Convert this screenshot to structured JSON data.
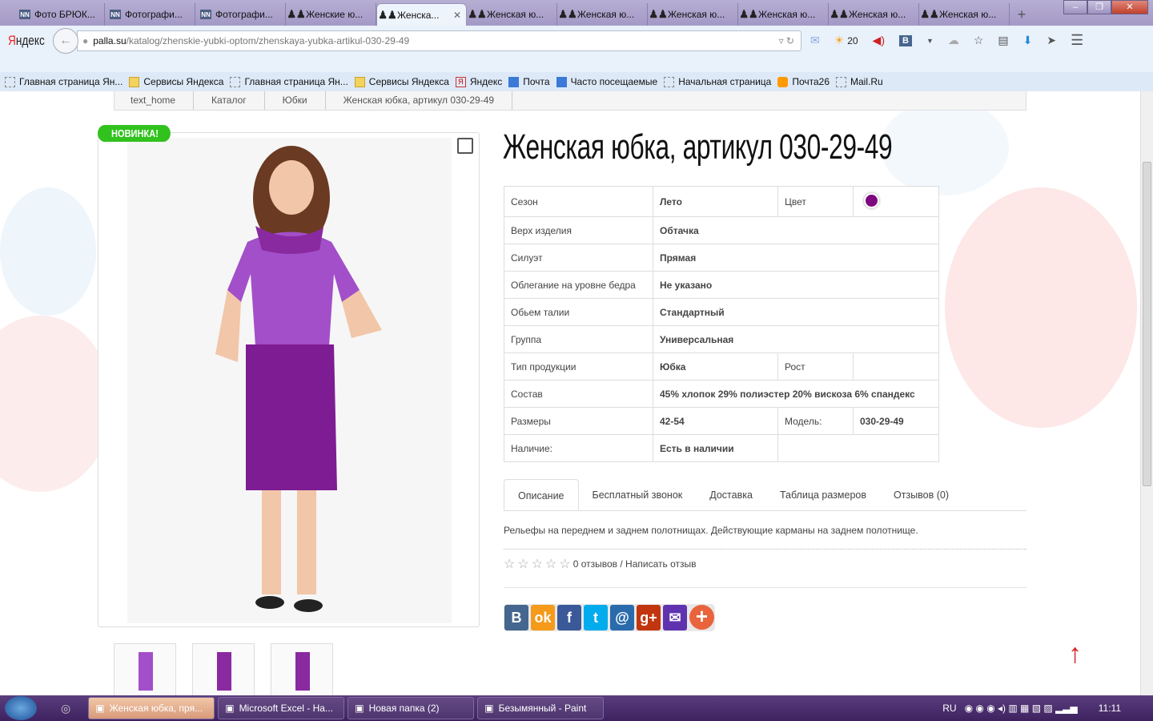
{
  "browser": {
    "tabs": [
      {
        "label": "Фото БРЮК...",
        "icon": "nn"
      },
      {
        "label": "Фотографи...",
        "icon": "nn"
      },
      {
        "label": "Фотографи...",
        "icon": "nn"
      },
      {
        "label": "Женские ю...",
        "icon": "palla"
      },
      {
        "label": "Женска...",
        "icon": "palla",
        "active": true
      },
      {
        "label": "Женская ю...",
        "icon": "palla"
      },
      {
        "label": "Женская ю...",
        "icon": "palla"
      },
      {
        "label": "Женская ю...",
        "icon": "palla"
      },
      {
        "label": "Женская ю...",
        "icon": "palla"
      },
      {
        "label": "Женская ю...",
        "icon": "palla"
      },
      {
        "label": "Женская ю...",
        "icon": "palla"
      }
    ],
    "logo_first": "Я",
    "logo_rest": "ндекс",
    "url_domain": "palla.su",
    "url_path": "/katalog/zhenskie-yubki-optom/zhenskaya-yubka-artikul-030-29-49",
    "weather_temp": "20",
    "bookmarks": [
      {
        "label": "Главная страница Ян...",
        "icon": "blank"
      },
      {
        "label": "Сервисы Яндекса",
        "icon": "folder"
      },
      {
        "label": "Главная страница Ян...",
        "icon": "blank"
      },
      {
        "label": "Сервисы Яндекса",
        "icon": "folder"
      },
      {
        "label": "Яндекс",
        "icon": "yandex"
      },
      {
        "label": "Почта",
        "icon": "mail"
      },
      {
        "label": "Часто посещаемые",
        "icon": "search"
      },
      {
        "label": "Начальная страница",
        "icon": "blank"
      },
      {
        "label": "Почта26",
        "icon": "at"
      },
      {
        "label": "Mail.Ru",
        "icon": "blank"
      }
    ]
  },
  "breadcrumb": [
    "text_home",
    "Каталог",
    "Юбки",
    "Женская юбка, артикул 030-29-49"
  ],
  "product": {
    "badge": "НОВИНКА!",
    "title": "Женская юбка, артикул 030-29-49",
    "color_swatch": "#7d0680",
    "specs": {
      "season_label": "Сезон",
      "season": "Лето",
      "color_label": "Цвет",
      "top_label": "Верх изделия",
      "top": "Обтачка",
      "silhouette_label": "Силуэт",
      "silhouette": "Прямая",
      "hip_label": "Облегание на уровне бедра",
      "hip": "Не указано",
      "waist_label": "Обьем талии",
      "waist": "Стандартный",
      "group_label": "Группа",
      "group": "Универсальная",
      "type_label": "Тип продукции",
      "type": "Юбка",
      "height_label": "Рост",
      "composition_label": "Состав",
      "composition": "45% хлопок 29% полиэстер 20% вискоза 6% спандекс",
      "sizes_label": "Размеры",
      "sizes": "42-54",
      "model_label": "Модель:",
      "model": "030-29-49",
      "stock_label": "Наличие:",
      "stock": "Есть в наличии"
    },
    "tabs": [
      "Описание",
      "Бесплатный звонок",
      "Доставка",
      "Таблица размеров",
      "Отзывов (0)"
    ],
    "description": "Рельефы на переднем и заднем полотнищах. Действующие карманы на заднем полотнище.",
    "rating": 0,
    "reviews_text": "0 отзывов / Написать отзыв",
    "share": [
      {
        "label": "B",
        "color": "#45668e"
      },
      {
        "label": "ok",
        "color": "#f59a1b"
      },
      {
        "label": "f",
        "color": "#3b5998"
      },
      {
        "label": "t",
        "color": "#00aced"
      },
      {
        "label": "@",
        "color": "#2a6bac"
      },
      {
        "label": "g+",
        "color": "#c1360e"
      },
      {
        "label": "✉",
        "color": "#5f33b0"
      },
      {
        "label": "+",
        "color": "#e9643c"
      }
    ]
  },
  "taskbar": {
    "items": [
      {
        "label": "Женская юбка, пря...",
        "active": true
      },
      {
        "label": "Microsoft Excel - На..."
      },
      {
        "label": "Новая папка (2)"
      },
      {
        "label": "Безымянный - Paint"
      }
    ],
    "lang": "RU",
    "time": "11:11"
  }
}
